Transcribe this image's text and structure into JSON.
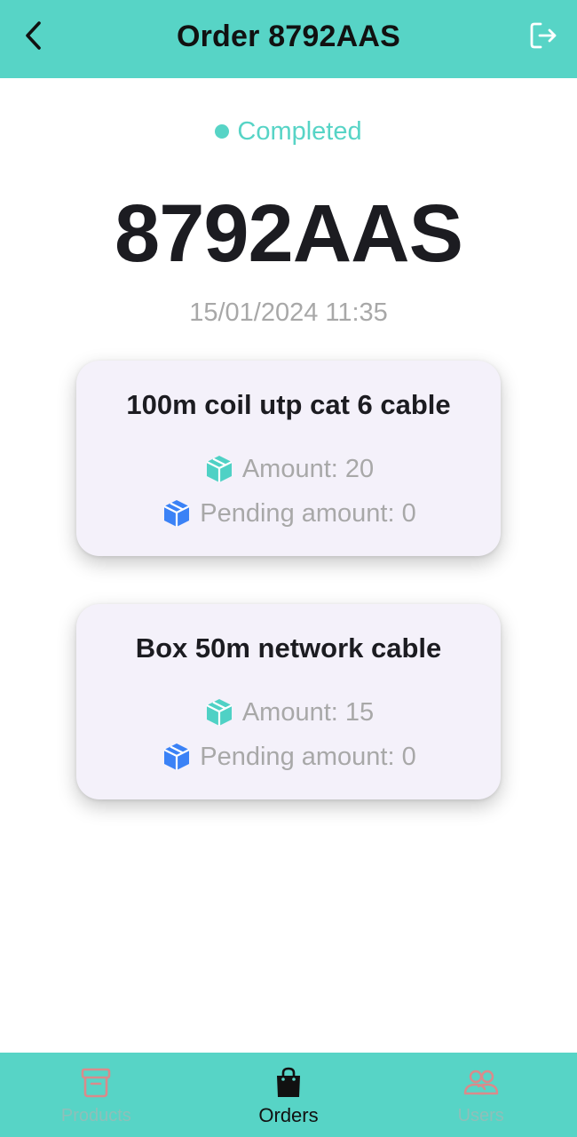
{
  "header": {
    "title": "Order 8792AAS",
    "back_icon": "chevron-left-icon",
    "logout_icon": "logout-icon"
  },
  "order": {
    "status": "Completed",
    "code": "8792AAS",
    "datetime": "15/01/2024 11:35"
  },
  "items": [
    {
      "name": "100m coil utp cat 6 cable",
      "amount_text": "Amount: 20",
      "pending_text": "Pending amount: 0"
    },
    {
      "name": "Box 50m network cable",
      "amount_text": "Amount: 15",
      "pending_text": "Pending amount: 0"
    }
  ],
  "nav": {
    "items": [
      {
        "label": "Products",
        "icon": "archive-box-icon",
        "active": false
      },
      {
        "label": "Orders",
        "icon": "shopping-bag-icon",
        "active": true
      },
      {
        "label": "Users",
        "icon": "users-icon",
        "active": false
      }
    ]
  },
  "colors": {
    "accent": "#57d4c6",
    "card_bg": "#f4f1fa",
    "amount_icon": "#4fd1c5",
    "pending_icon": "#3b82f6",
    "muted_text": "#a8a8a8"
  }
}
